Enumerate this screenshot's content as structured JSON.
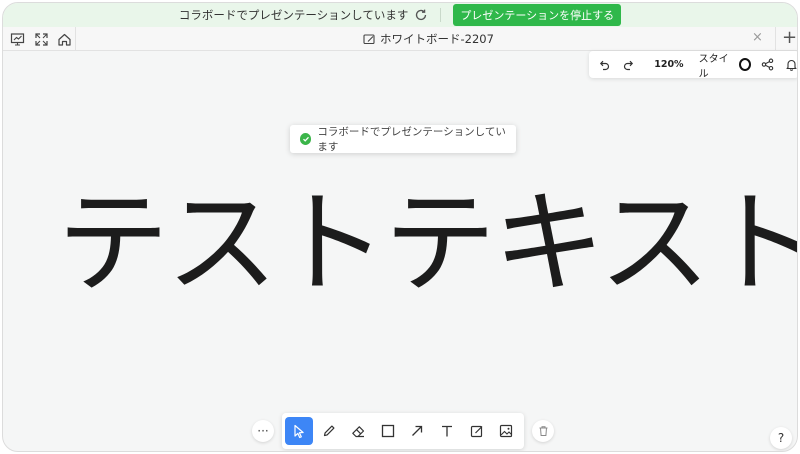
{
  "banner": {
    "message": "コラボードでプレゼンテーションしています",
    "stop_label": "プレゼンテーションを停止する"
  },
  "tab": {
    "title": "ホワイトボード-2207",
    "close_glyph": "×",
    "new_tab_glyph": "+"
  },
  "toolbar_right": {
    "zoom": "120%",
    "style_label": "スタイル"
  },
  "toast": {
    "message": "コラボードでプレゼンテーションしています"
  },
  "canvas": {
    "text": "テストテキスト"
  },
  "bottom_toolbar": {
    "more_glyph": "···",
    "help_glyph": "?"
  },
  "colors": {
    "banner_bg": "#e9f6ea",
    "stop_button": "#2fb84a",
    "active_tool": "#3d86f6",
    "success_check": "#3bb54a"
  }
}
